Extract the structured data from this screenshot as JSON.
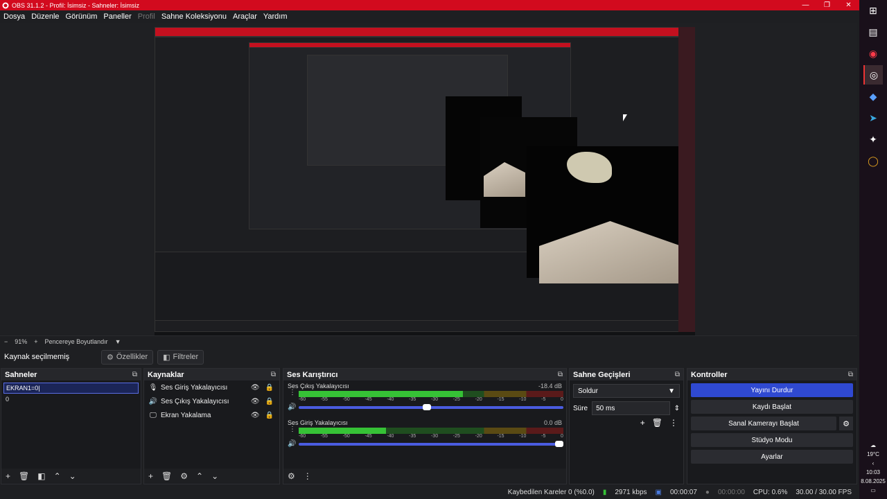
{
  "window": {
    "title": "OBS 31.1.2 - Profil: İsimsiz - Sahneler: İsimsiz"
  },
  "menu": [
    "Dosya",
    "Düzenle",
    "Görünüm",
    "Paneller",
    "Profil",
    "Sahne Koleksiyonu",
    "Araçlar",
    "Yardım"
  ],
  "preview": {
    "zoom": "91%",
    "mode": "Pencereye Boyutlandır"
  },
  "source_toolbar": {
    "no_source": "Kaynak seçilmemiş",
    "properties": "Özellikler",
    "filters": "Filtreler"
  },
  "scenes": {
    "title": "Sahneler",
    "items": [
      "EKRAN1=0|",
      "0"
    ]
  },
  "sources": {
    "title": "Kaynaklar",
    "items": [
      "Ses Giriş Yakalayıcısı",
      "Ses Çıkış Yakalayıcısı",
      "Ekran Yakalama"
    ]
  },
  "mixer": {
    "title": "Ses Karıştırıcı",
    "scale": [
      "-60",
      "-55",
      "-50",
      "-45",
      "-40",
      "-35",
      "-30",
      "-25",
      "-20",
      "-15",
      "-10",
      "-5",
      "0"
    ],
    "channels": [
      {
        "name": "Ses Çıkış Yakalayıcısı",
        "db": "-18.4 dB",
        "level": 0.62,
        "volume": 0.5
      },
      {
        "name": "Ses Giriş Yakalayıcısı",
        "db": "0.0 dB",
        "level": 0.33,
        "volume": 1.0
      }
    ]
  },
  "transitions": {
    "title": "Sahne Geçişleri",
    "selected": "Soldur",
    "duration_label": "Süre",
    "duration": "50 ms"
  },
  "controls": {
    "title": "Kontroller",
    "stop_stream": "Yayını Durdur",
    "start_record": "Kaydı Başlat",
    "virtual_cam": "Sanal Kamerayı Başlat",
    "studio_mode": "Stüdyo Modu",
    "settings": "Ayarlar"
  },
  "status": {
    "dropped": "Kaybedilen Kareler 0 (%0.0)",
    "bitrate": "2971 kbps",
    "stream_time": "00:00:07",
    "record_time": "00:00:00",
    "cpu": "CPU: 0.6%",
    "fps": "30.00 / 30.00 FPS"
  },
  "tray": {
    "temp": "19°C",
    "time": "10:03",
    "date": "8.08.2025"
  },
  "colors": {
    "titlebar": "#d20a1e",
    "accent": "#2f49d1"
  }
}
